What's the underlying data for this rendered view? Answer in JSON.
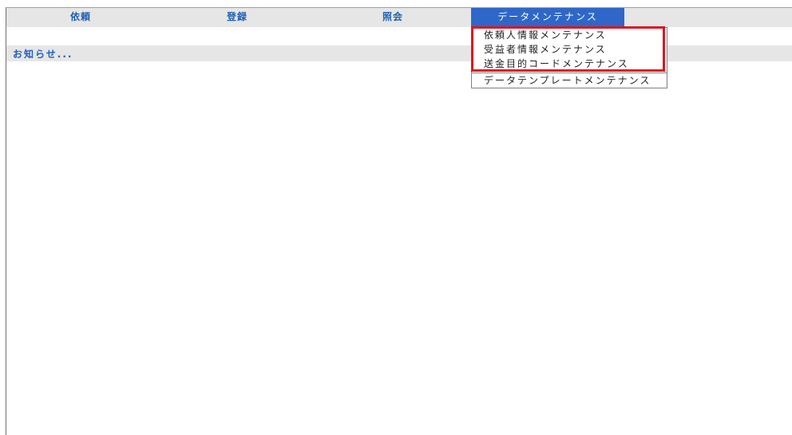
{
  "menu": {
    "items": [
      {
        "label": "依頼"
      },
      {
        "label": "登録"
      },
      {
        "label": "照会"
      },
      {
        "label": "データメンテナンス"
      }
    ]
  },
  "notice": {
    "label": "お知らせ..."
  },
  "dropdown": {
    "items": [
      {
        "label": "依頼人情報メンテナンス"
      },
      {
        "label": "受益者情報メンテナンス"
      },
      {
        "label": "送金目的コードメンテナンス"
      },
      {
        "label": "データテンプレートメンテナンス"
      }
    ]
  },
  "colors": {
    "menu_text": "#1f5fb5",
    "active_menu_bg": "#2f67c9",
    "highlight_border": "#e0141e"
  }
}
